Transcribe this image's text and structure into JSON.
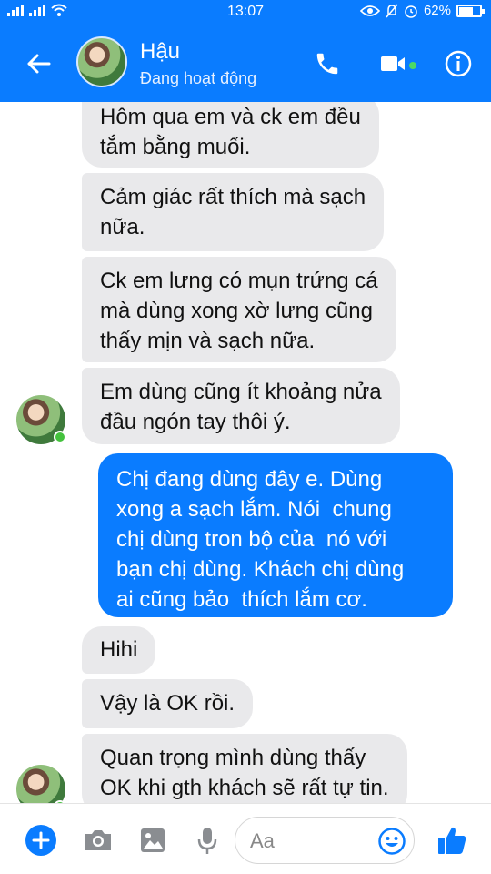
{
  "status_bar": {
    "carrier_signal": ".ıl .ıl",
    "time": "13:07",
    "battery_percent_text": "62%",
    "battery_level": 0.62
  },
  "header": {
    "contact_name": "Hậu",
    "contact_status": "Đang hoạt động",
    "accent_color": "#0a7cff"
  },
  "messages": [
    {
      "id": "m1",
      "direction": "incoming",
      "lines": [
        "Hôm qua em và ck em đều",
        "tắm bằng muối."
      ]
    },
    {
      "id": "m2",
      "direction": "incoming",
      "lines": [
        "Cảm giác rất thích mà sạch",
        "nữa."
      ]
    },
    {
      "id": "m3",
      "direction": "incoming",
      "lines": [
        "Ck em lưng có mụn trứng cá",
        "mà dùng xong xờ lưng cũng",
        "thấy mịn và sạch nữa."
      ]
    },
    {
      "id": "m4",
      "direction": "incoming",
      "lines": [
        "Em dùng cũng ít khoảng nửa",
        "đầu ngón tay thôi ý."
      ]
    },
    {
      "id": "m5",
      "direction": "outgoing",
      "lines": [
        "Chị đang dùng đây e. Dùng",
        "xong a sạch lắm. Nói  chung",
        "chị dùng tron bộ của  nó với",
        "bạn chị dùng. Khách chị dùng",
        "ai cũng bảo  thích lắm cơ."
      ]
    },
    {
      "id": "m6",
      "direction": "incoming",
      "lines": [
        "Hihi"
      ]
    },
    {
      "id": "m7",
      "direction": "incoming",
      "lines": [
        "Vậy là OK rồi."
      ]
    },
    {
      "id": "m8",
      "direction": "incoming",
      "lines": [
        "Quan trọng mình dùng thấy",
        "OK khi gth khách sẽ rất tự tin."
      ]
    }
  ],
  "composer": {
    "placeholder": "Aa",
    "icons": [
      "plus-icon",
      "camera-icon",
      "image-icon",
      "microphone-icon",
      "emoji-icon",
      "thumbs-up-icon"
    ]
  },
  "colors": {
    "incoming_bubble": "#e9e9eb",
    "outgoing_bubble": "#0a7cff",
    "online": "#44c23d"
  }
}
